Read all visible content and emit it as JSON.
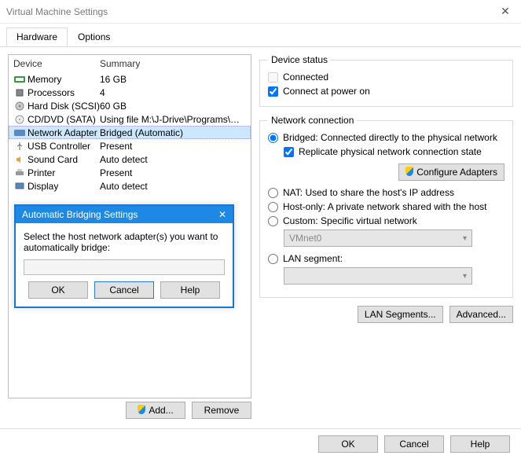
{
  "window": {
    "title": "Virtual Machine Settings",
    "close": "✕"
  },
  "tabs": {
    "hardware": "Hardware",
    "options": "Options"
  },
  "list": {
    "h1": "Device",
    "h2": "Summary",
    "rows": [
      {
        "d": "Memory",
        "s": "16 GB"
      },
      {
        "d": "Processors",
        "s": "4"
      },
      {
        "d": "Hard Disk (SCSI)",
        "s": "60 GB"
      },
      {
        "d": "CD/DVD (SATA)",
        "s": "Using file M:\\J-Drive\\Programs\\Wi..."
      },
      {
        "d": "Network Adapter",
        "s": "Bridged (Automatic)"
      },
      {
        "d": "USB Controller",
        "s": "Present"
      },
      {
        "d": "Sound Card",
        "s": "Auto detect"
      },
      {
        "d": "Printer",
        "s": "Present"
      },
      {
        "d": "Display",
        "s": "Auto detect"
      }
    ]
  },
  "leftbtns": {
    "add": "Add...",
    "remove": "Remove"
  },
  "status": {
    "legend": "Device status",
    "connected": "Connected",
    "power": "Connect at power on"
  },
  "net": {
    "legend": "Network connection",
    "bridged": "Bridged: Connected directly to the physical network",
    "replicate": "Replicate physical network connection state",
    "cfg": "Configure Adapters",
    "nat": "NAT: Used to share the host's IP address",
    "host": "Host-only: A private network shared with the host",
    "custom": "Custom: Specific virtual network",
    "vmnet": "VMnet0",
    "lanseg": "LAN segment:",
    "lansegbtn": "LAN Segments...",
    "adv": "Advanced..."
  },
  "modal": {
    "title": "Automatic Bridging Settings",
    "text": "Select the host network adapter(s) you want to automatically bridge:",
    "ok": "OK",
    "cancel": "Cancel",
    "help": "Help"
  },
  "footer": {
    "ok": "OK",
    "cancel": "Cancel",
    "help": "Help"
  }
}
